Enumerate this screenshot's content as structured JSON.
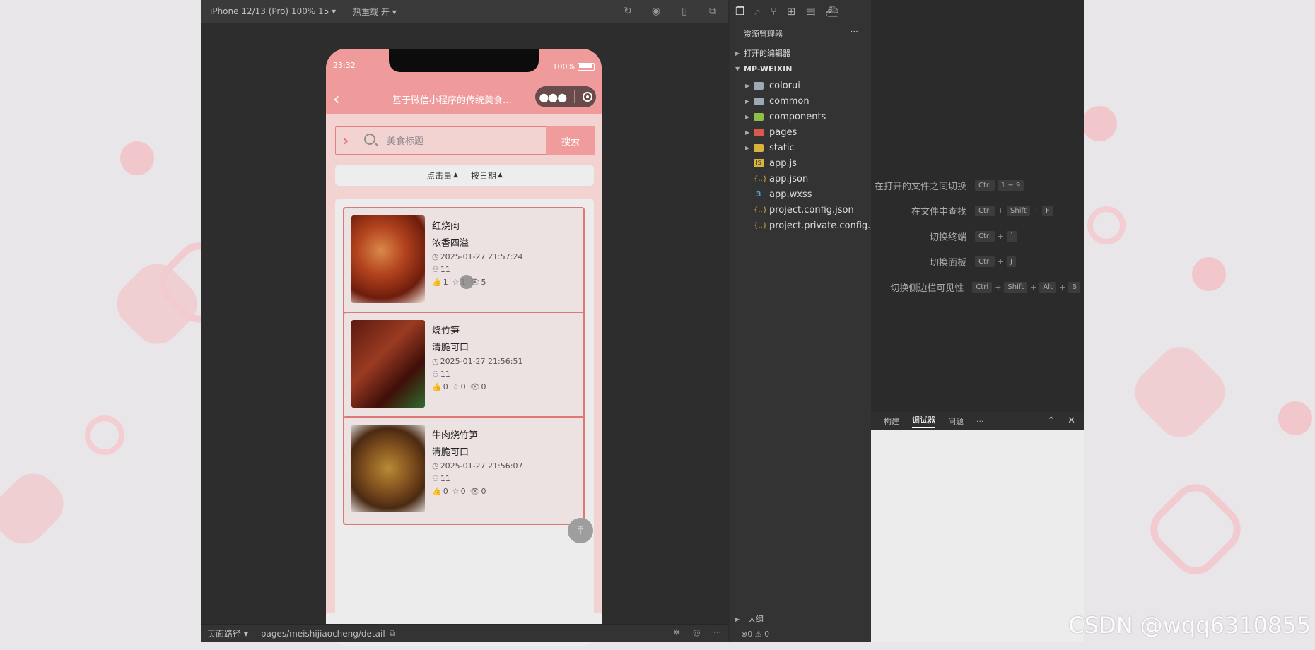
{
  "simulator": {
    "device_label": "iPhone 12/13 (Pro) 100% 15 ▾",
    "hot_reload": "热重载 开 ▾",
    "bottom_path_label": "页面路径 ▾",
    "bottom_path": "pages/meishijiaocheng/detail"
  },
  "phone": {
    "time": "23:32",
    "battery": "100%",
    "nav_title": "基于微信小程序的传统美食文化...",
    "search_placeholder": "美食标题",
    "search_button": "搜索",
    "sort": [
      "点击量",
      "按日期"
    ],
    "cards": [
      {
        "title": "红烧肉",
        "subtitle": "浓香四溢",
        "date": "2025-01-27 21:57:24",
        "user": "11",
        "likes": "1",
        "favorites": "1",
        "views": "5"
      },
      {
        "title": "烧竹笋",
        "subtitle": "清脆可口",
        "date": "2025-01-27 21:56:51",
        "user": "11",
        "likes": "0",
        "favorites": "0",
        "views": "0"
      },
      {
        "title": "牛肉烧竹笋",
        "subtitle": "清脆可口",
        "date": "2025-01-27 21:56:07",
        "user": "11",
        "likes": "0",
        "favorites": "0",
        "views": "0"
      }
    ]
  },
  "explorer": {
    "header": "资源管理器",
    "open_editors": "打开的编辑器",
    "project": "MP-WEIXIN",
    "folders": [
      "colorui",
      "common",
      "components",
      "pages",
      "static"
    ],
    "files": [
      "app.js",
      "app.json",
      "app.wxss",
      "project.config.json",
      "project.private.config.js..."
    ],
    "outline": "大纲",
    "status": "0 ⚠ 0"
  },
  "shortcuts": [
    {
      "label": "在打开的文件之间切换",
      "keys": [
        "Ctrl",
        "1 ~ 9"
      ]
    },
    {
      "label": "在文件中查找",
      "keys": [
        "Ctrl",
        "Shift",
        "F"
      ]
    },
    {
      "label": "切换终端",
      "keys": [
        "Ctrl",
        "`"
      ]
    },
    {
      "label": "切换面板",
      "keys": [
        "Ctrl",
        "J"
      ]
    },
    {
      "label": "切换侧边栏可见性",
      "keys": [
        "Ctrl",
        "Shift",
        "Alt",
        "B"
      ]
    }
  ],
  "panel_tabs": [
    "构建",
    "调试器",
    "问题",
    "···"
  ],
  "watermark": "CSDN @wqq6310855"
}
